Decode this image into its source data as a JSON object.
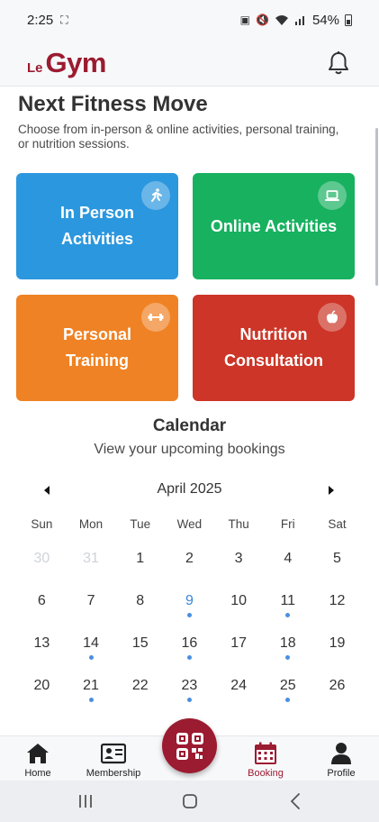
{
  "status_bar": {
    "time": "2:25",
    "battery": "54%"
  },
  "header": {
    "logo_prefix": "Le",
    "logo_main": "Gym"
  },
  "intro": {
    "title": "Next Fitness Move",
    "subtitle": "Choose from in-person & online activities, personal training, or nutrition sessions."
  },
  "cards": [
    {
      "label": "In Person Activities",
      "icon": "running-person-icon",
      "color": "#2b97de"
    },
    {
      "label": "Online Activities",
      "icon": "laptop-icon",
      "color": "#17b15f"
    },
    {
      "label": "Personal Training",
      "icon": "dumbbell-icon",
      "color": "#ef8224"
    },
    {
      "label": "Nutrition Consultation",
      "icon": "apple-icon",
      "color": "#cc3527"
    }
  ],
  "calendar": {
    "title": "Calendar",
    "subtitle": "View your upcoming bookings",
    "month": "April 2025",
    "weekdays": [
      "Sun",
      "Mon",
      "Tue",
      "Wed",
      "Thu",
      "Fri",
      "Sat"
    ],
    "weeks": [
      [
        {
          "d": "30",
          "muted": true
        },
        {
          "d": "31",
          "muted": true
        },
        {
          "d": "1"
        },
        {
          "d": "2"
        },
        {
          "d": "3"
        },
        {
          "d": "4"
        },
        {
          "d": "5"
        }
      ],
      [
        {
          "d": "6"
        },
        {
          "d": "7"
        },
        {
          "d": "8"
        },
        {
          "d": "9",
          "today": true,
          "booked": true
        },
        {
          "d": "10"
        },
        {
          "d": "11",
          "booked": true
        },
        {
          "d": "12"
        }
      ],
      [
        {
          "d": "13"
        },
        {
          "d": "14",
          "booked": true
        },
        {
          "d": "15"
        },
        {
          "d": "16",
          "booked": true
        },
        {
          "d": "17"
        },
        {
          "d": "18",
          "booked": true
        },
        {
          "d": "19"
        }
      ],
      [
        {
          "d": "20"
        },
        {
          "d": "21",
          "booked": true
        },
        {
          "d": "22"
        },
        {
          "d": "23",
          "booked": true
        },
        {
          "d": "24"
        },
        {
          "d": "25",
          "booked": true
        },
        {
          "d": "26"
        }
      ]
    ]
  },
  "bottom_nav": {
    "home": "Home",
    "membership": "Membership",
    "booking": "Booking",
    "profile": "Profile"
  },
  "colors": {
    "brand": "#9b1b30",
    "booking_dot": "#4a8fe0",
    "today": "#3a87d6"
  }
}
